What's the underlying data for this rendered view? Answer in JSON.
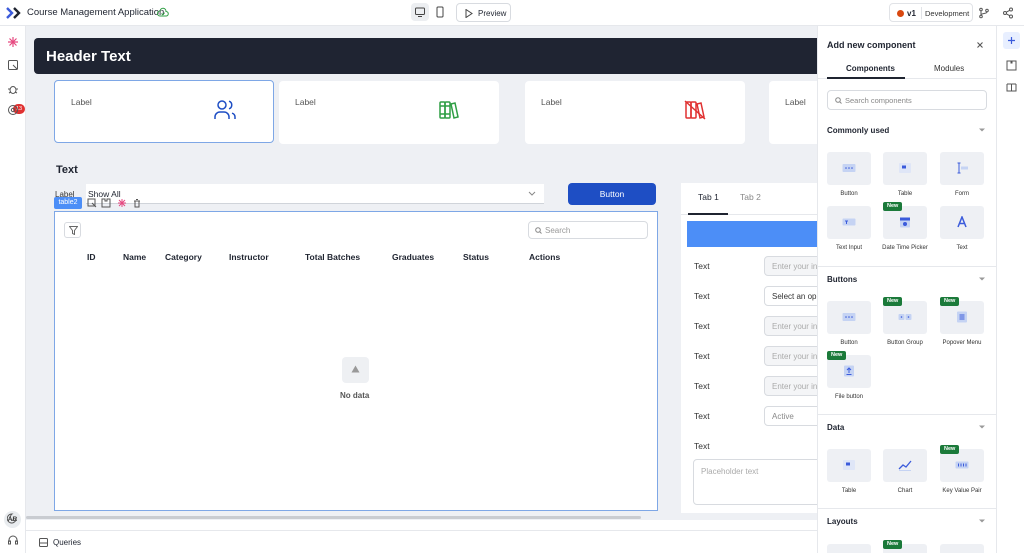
{
  "app": {
    "title": "Course Management Application"
  },
  "topbar": {
    "preview_label": "Preview",
    "version": "v1",
    "environment": "Development"
  },
  "left_rail": {
    "badge_count": "13",
    "avatar_initials": "AR"
  },
  "canvas": {
    "header_text": "Header Text",
    "cards": [
      {
        "label": "Label",
        "icon": "users-icon",
        "color": "#1e4ec4"
      },
      {
        "label": "Label",
        "icon": "books-icon",
        "color": "#2f9e44"
      },
      {
        "label": "Label",
        "icon": "books-off-icon",
        "color": "#e03131"
      },
      {
        "label": "Label",
        "icon": "",
        "color": ""
      }
    ],
    "section_text": "Text",
    "filter_label": "Label",
    "filter_value": "Show All",
    "button_label": "Button",
    "table": {
      "tag": "table2",
      "search_placeholder": "Search",
      "columns": [
        "ID",
        "Name",
        "Category",
        "Instructor",
        "Total Batches",
        "Graduates",
        "Status",
        "Actions"
      ],
      "empty_text": "No data"
    },
    "form": {
      "tabs": [
        "Tab 1",
        "Tab 2"
      ],
      "fields": [
        {
          "label": "Text",
          "placeholder": "Enter your in"
        },
        {
          "label": "Text",
          "placeholder": "Select an op"
        },
        {
          "label": "Text",
          "placeholder": "Enter your in"
        },
        {
          "label": "Text",
          "placeholder": "Enter your in"
        },
        {
          "label": "Text",
          "placeholder": "Enter your in"
        },
        {
          "label": "Text",
          "placeholder": "Active"
        }
      ],
      "textarea_label": "Text",
      "textarea_placeholder": "Placeholder text"
    }
  },
  "bottombar": {
    "queries_label": "Queries"
  },
  "right_panel": {
    "title": "Add new component",
    "tabs": [
      "Components",
      "Modules"
    ],
    "search_placeholder": "Search components",
    "sections": [
      {
        "title": "Commonly used",
        "items": [
          {
            "name": "Button",
            "new": false
          },
          {
            "name": "Table",
            "new": false
          },
          {
            "name": "Form",
            "new": false
          },
          {
            "name": "Text Input",
            "new": false
          },
          {
            "name": "Date Time Picker",
            "new": true
          },
          {
            "name": "Text",
            "new": false
          }
        ]
      },
      {
        "title": "Buttons",
        "items": [
          {
            "name": "Button",
            "new": false
          },
          {
            "name": "Button Group",
            "new": true
          },
          {
            "name": "Popover Menu",
            "new": true
          },
          {
            "name": "File button",
            "new": true
          }
        ]
      },
      {
        "title": "Data",
        "items": [
          {
            "name": "Table",
            "new": false
          },
          {
            "name": "Chart",
            "new": false
          },
          {
            "name": "Key Value Pair",
            "new": true
          }
        ]
      },
      {
        "title": "Layouts",
        "items": []
      }
    ],
    "new_badge": "New"
  },
  "colors": {
    "accent": "#1e4ec4",
    "header_bg": "#1f2432",
    "new_badge": "#1b7a3a",
    "selection": "#4c8ef7"
  }
}
